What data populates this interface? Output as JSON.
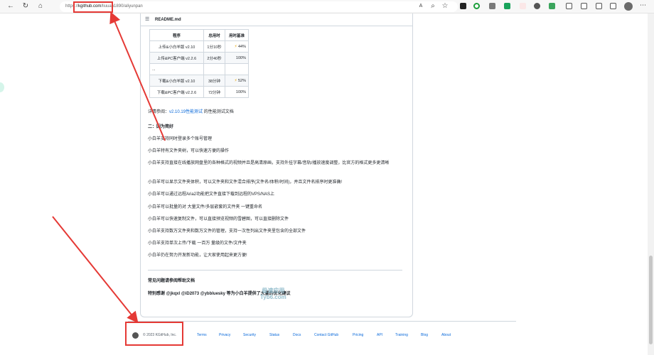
{
  "browser": {
    "url_prefix": "https://",
    "url_host": "kgithub.com",
    "url_rest": "/liu",
    "url_tail": "uan1890/aliyunpan"
  },
  "readme": {
    "title": "README.md",
    "table": {
      "headers": [
        "程序",
        "总用时",
        "用时基准"
      ],
      "rows": [
        {
          "program": "上传&小白羊版 v2.10",
          "time": "1分10秒",
          "bench": "44%",
          "bolt": true
        },
        {
          "program": "上传&PC客户端 v2.2.6",
          "time": "2分40秒",
          "bench": "100%",
          "bolt": false
        },
        {
          "program": "...",
          "time": "",
          "bench": "",
          "bolt": false
        },
        {
          "program": "下载&小白羊版 v2.10",
          "time": "38分钟",
          "bench": "52%",
          "bolt": true
        },
        {
          "program": "下载&PC客户端 v2.2.6",
          "time": "72分钟",
          "bench": "100%",
          "bolt": false
        }
      ]
    },
    "detail_prefix": "详情参阅：",
    "detail_link": "v2.10.19性能测试",
    "detail_suffix": " 的性能测试文档",
    "section_title": "二：因为简好",
    "features": [
      "小白羊支持同时登录多个账号管理",
      "小白羊特有文件夹树，可以快速方便的操作",
      "小白羊支持直接在线播放网盘里的各种格式的视频并且是高清原画，支持外挂字幕/音轨/播放速度调整，比官方的格式更多更清晰",
      "小白羊可以显示文件夹体积，可以文件夹和文件混合排序(文件名/体积/时间)，并且文件名排序时更准确!",
      "小白羊可以通过远程Aria2功能把文件直接下载到远程的VPS/NAS上",
      "小白羊可以批量的对 大量文件/多层嵌套的文件夹 一键重命名",
      "小白羊可以快速复制文件，可以直接预览视频的雪碧图，可以直接删除文件",
      "小白羊支持数万文件夹和数万文件的管理，支持一次性列出文件夹里包含的全部文件",
      "小白羊支持单次上传/下载 一百万 量级的文件/文件夹",
      "小白羊仍在努力开发新功能，让大家使用起来更方便!"
    ],
    "faq": "常见问题请参阅帮助文档",
    "thanks": "特别感谢 @jkqxl @iD2073 @ybbluesky 等为小白羊提供了大量的优化建议"
  },
  "watermark": {
    "line1": "极速应用",
    "line2": "Tyb6.com"
  },
  "footer": {
    "copyright": "© 2023 KGitHub, Inc.",
    "links": [
      "Terms",
      "Privacy",
      "Security",
      "Status",
      "Docs",
      "Contact GitHub",
      "Pricing",
      "API",
      "Training",
      "Blog",
      "About"
    ]
  },
  "colors": {
    "annotation": "#e53935",
    "link": "#0969da",
    "bolt": "#e8a400"
  },
  "icons": [
    "back-icon",
    "refresh-icon",
    "home-icon",
    "read-aloud-icon",
    "zoom-icon",
    "favorite-icon",
    "github-logo-icon",
    "list-icon",
    "lightning-icon"
  ]
}
